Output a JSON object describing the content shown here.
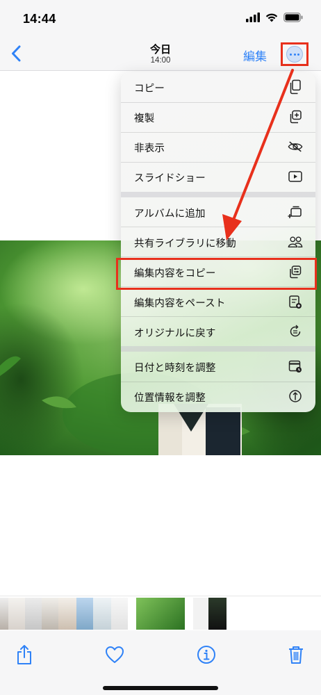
{
  "status_bar": {
    "time": "14:44"
  },
  "nav": {
    "title": "今日",
    "subtitle": "14:00",
    "edit_label": "編集"
  },
  "menu": {
    "groups": [
      [
        {
          "label": "コピー",
          "icon": "copy-icon"
        },
        {
          "label": "複製",
          "icon": "duplicate-icon"
        },
        {
          "label": "非表示",
          "icon": "eye-slash-icon"
        },
        {
          "label": "スライドショー",
          "icon": "play-icon"
        }
      ],
      [
        {
          "label": "アルバムに追加",
          "icon": "add-to-album-icon"
        },
        {
          "label": "共有ライブラリに移動",
          "icon": "people-icon"
        },
        {
          "label": "編集内容をコピー",
          "icon": "copy-edits-icon"
        },
        {
          "label": "編集内容をペースト",
          "icon": "paste-edits-icon"
        },
        {
          "label": "オリジナルに戻す",
          "icon": "revert-icon"
        }
      ],
      [
        {
          "label": "日付と時刻を調整",
          "icon": "calendar-icon"
        },
        {
          "label": "位置情報を調整",
          "icon": "location-icon"
        }
      ]
    ]
  },
  "toolbar": {
    "icons": [
      "share-icon",
      "heart-icon",
      "info-icon",
      "trash-icon"
    ]
  },
  "colors": {
    "accent": "#2f82f7",
    "annotation": "#e8301c"
  }
}
